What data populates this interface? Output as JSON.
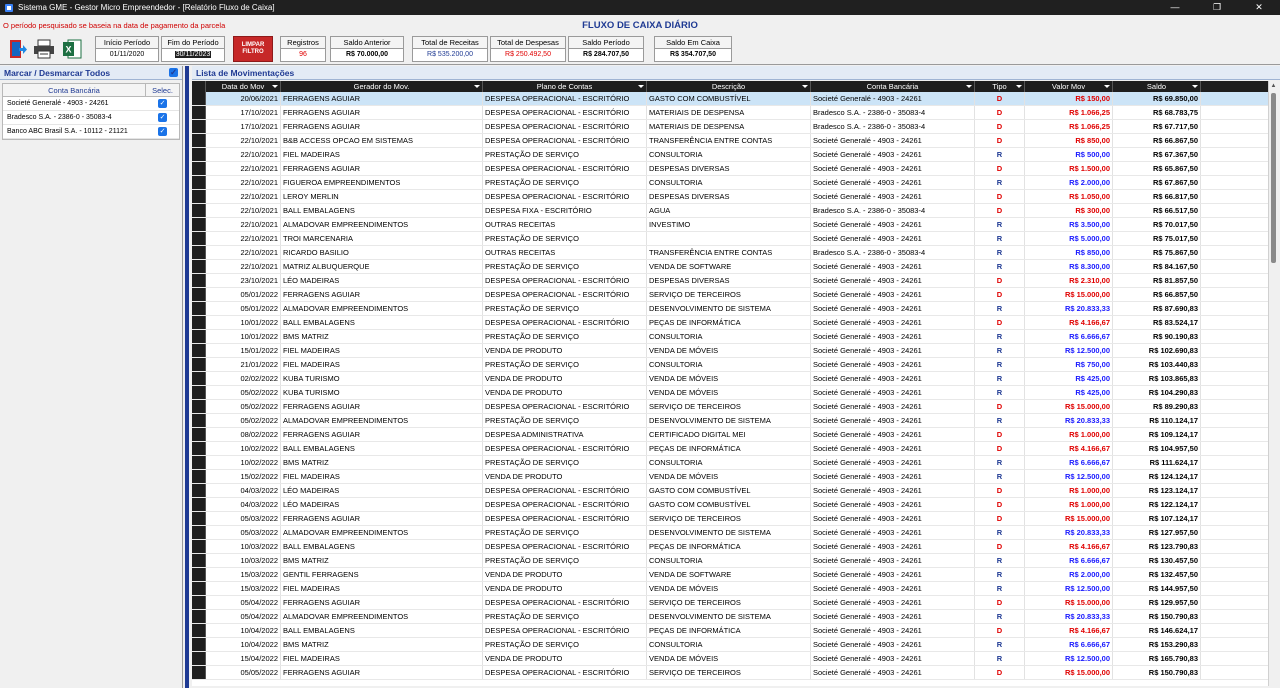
{
  "window": {
    "title": "Sistema GME - Gestor Micro Empreendedor - [Relatório Fluxo de Caixa]"
  },
  "header": {
    "notice": "O período pesquisado se baseia na data de pagamento da parcela",
    "title": "FLUXO DE CAIXA DIÁRIO"
  },
  "filters": {
    "inicio_label": "Início Período",
    "inicio_value": "01/11/2020",
    "fim_label": "Fim do Período",
    "fim_value": "30/11/2023",
    "limpar_label": "LIMPAR FILTRO",
    "registros_label": "Registros",
    "registros_value": "96"
  },
  "summary": {
    "saldo_anterior_label": "Saldo Anterior",
    "saldo_anterior_value": "R$ 70.000,00",
    "total_receitas_label": "Total de Receitas",
    "total_receitas_value": "R$ 535.200,00",
    "total_despesas_label": "Total de Despesas",
    "total_despesas_value": "R$ 250.492,50",
    "saldo_periodo_label": "Saldo Período",
    "saldo_periodo_value": "R$ 284.707,50",
    "saldo_caixa_label": "Saldo Em Caixa",
    "saldo_caixa_value": "R$ 354.707,50",
    "colors": {
      "receita": "#1f3a93",
      "despesa": "#e00000"
    }
  },
  "left": {
    "title": "Marcar / Desmarcar Todos",
    "col_conta": "Conta Bancária",
    "col_selec": "Selec.",
    "accounts": [
      "Societé Generalé - 4903 - 24261",
      "Bradesco S.A. - 2386-0 - 35083-4",
      "Banco ABC Brasil S.A. - 10112 - 21121"
    ]
  },
  "grid": {
    "title": "Lista de Movimentações",
    "headers": [
      "Data do Mov",
      "Gerador do Mov.",
      "Plano de Contas",
      "Descrição",
      "Conta Bancária",
      "Tipo",
      "Valor Mov",
      "Saldo"
    ],
    "rows": [
      [
        "20/06/2021",
        "FERRAGENS AGUIAR",
        "DESPESA OPERACIONAL - ESCRITÓRIO",
        "GASTO COM COMBUSTÍVEL",
        "Societé Generalé - 4903 - 24261",
        "D",
        "R$ 150,00",
        "R$ 69.850,00"
      ],
      [
        "17/10/2021",
        "FERRAGENS AGUIAR",
        "DESPESA OPERACIONAL - ESCRITÓRIO",
        "MATERIAIS DE DESPENSA",
        "Bradesco S.A. - 2386-0 - 35083-4",
        "D",
        "R$ 1.066,25",
        "R$ 68.783,75"
      ],
      [
        "17/10/2021",
        "FERRAGENS AGUIAR",
        "DESPESA OPERACIONAL - ESCRITÓRIO",
        "MATERIAIS DE DESPENSA",
        "Bradesco S.A. - 2386-0 - 35083-4",
        "D",
        "R$ 1.066,25",
        "R$ 67.717,50"
      ],
      [
        "22/10/2021",
        "B&B ACCESS OPCAO EM SISTEMAS",
        "DESPESA OPERACIONAL - ESCRITÓRIO",
        "TRANSFERÊNCIA ENTRE CONTAS",
        "Societé Generalé - 4903 - 24261",
        "D",
        "R$ 850,00",
        "R$ 66.867,50"
      ],
      [
        "22/10/2021",
        "FIEL MADEIRAS",
        "PRESTAÇÃO DE SERVIÇO",
        "CONSULTORIA",
        "Societé Generalé - 4903 - 24261",
        "R",
        "R$ 500,00",
        "R$ 67.367,50"
      ],
      [
        "22/10/2021",
        "FERRAGENS AGUIAR",
        "DESPESA OPERACIONAL - ESCRITÓRIO",
        "DESPESAS DIVERSAS",
        "Societé Generalé - 4903 - 24261",
        "D",
        "R$ 1.500,00",
        "R$ 65.867,50"
      ],
      [
        "22/10/2021",
        "FIGUEROA EMPREENDIMENTOS",
        "PRESTAÇÃO DE SERVIÇO",
        "CONSULTORIA",
        "Societé Generalé - 4903 - 24261",
        "R",
        "R$ 2.000,00",
        "R$ 67.867,50"
      ],
      [
        "22/10/2021",
        "LEROY MERLIN",
        "DESPESA OPERACIONAL - ESCRITÓRIO",
        "DESPESAS DIVERSAS",
        "Societé Generalé - 4903 - 24261",
        "D",
        "R$ 1.050,00",
        "R$ 66.817,50"
      ],
      [
        "22/10/2021",
        "BALL EMBALAGENS",
        "DESPESA FIXA - ESCRITÓRIO",
        "AGUA",
        "Bradesco S.A. - 2386-0 - 35083-4",
        "D",
        "R$ 300,00",
        "R$ 66.517,50"
      ],
      [
        "22/10/2021",
        "ALMADOVAR EMPREENDIMENTOS",
        "OUTRAS RECEITAS",
        "INVESTIMO",
        "Societé Generalé - 4903 - 24261",
        "R",
        "R$ 3.500,00",
        "R$ 70.017,50"
      ],
      [
        "22/10/2021",
        "TROI MARCENARIA",
        "PRESTAÇÃO DE SERVIÇO",
        "",
        "Societé Generalé - 4903 - 24261",
        "R",
        "R$ 5.000,00",
        "R$ 75.017,50"
      ],
      [
        "22/10/2021",
        "RICARDO BASILIO",
        "OUTRAS RECEITAS",
        "TRANSFERÊNCIA ENTRE CONTAS",
        "Bradesco S.A. - 2386-0 - 35083-4",
        "R",
        "R$ 850,00",
        "R$ 75.867,50"
      ],
      [
        "22/10/2021",
        "MATRIZ ALBUQUERQUE",
        "PRESTAÇÃO DE SERVIÇO",
        "VENDA DE SOFTWARE",
        "Societé Generalé - 4903 - 24261",
        "R",
        "R$ 8.300,00",
        "R$ 84.167,50"
      ],
      [
        "23/10/2021",
        "LÉO MADEIRAS",
        "DESPESA OPERACIONAL - ESCRITÓRIO",
        "DESPESAS DIVERSAS",
        "Societé Generalé - 4903 - 24261",
        "D",
        "R$ 2.310,00",
        "R$ 81.857,50"
      ],
      [
        "05/01/2022",
        "FERRAGENS AGUIAR",
        "DESPESA OPERACIONAL - ESCRITÓRIO",
        "SERVIÇO DE TERCEIROS",
        "Societé Generalé - 4903 - 24261",
        "D",
        "R$ 15.000,00",
        "R$ 66.857,50"
      ],
      [
        "05/01/2022",
        "ALMADOVAR EMPREENDIMENTOS",
        "PRESTAÇÃO DE SERVIÇO",
        "DESENVOLVIMENTO DE SISTEMA",
        "Societé Generalé - 4903 - 24261",
        "R",
        "R$ 20.833,33",
        "R$ 87.690,83"
      ],
      [
        "10/01/2022",
        "BALL EMBALAGENS",
        "DESPESA OPERACIONAL - ESCRITÓRIO",
        "PEÇAS DE INFORMÁTICA",
        "Societé Generalé - 4903 - 24261",
        "D",
        "R$ 4.166,67",
        "R$ 83.524,17"
      ],
      [
        "10/01/2022",
        "BMS MATRIZ",
        "PRESTAÇÃO DE SERVIÇO",
        "CONSULTORIA",
        "Societé Generalé - 4903 - 24261",
        "R",
        "R$ 6.666,67",
        "R$ 90.190,83"
      ],
      [
        "15/01/2022",
        "FIEL MADEIRAS",
        "VENDA DE PRODUTO",
        "VENDA DE MÓVEIS",
        "Societé Generalé - 4903 - 24261",
        "R",
        "R$ 12.500,00",
        "R$ 102.690,83"
      ],
      [
        "21/01/2022",
        "FIEL MADEIRAS",
        "PRESTAÇÃO DE SERVIÇO",
        "CONSULTORIA",
        "Societé Generalé - 4903 - 24261",
        "R",
        "R$ 750,00",
        "R$ 103.440,83"
      ],
      [
        "02/02/2022",
        "KUBA TURISMO",
        "VENDA DE PRODUTO",
        "VENDA DE MÓVEIS",
        "Societé Generalé - 4903 - 24261",
        "R",
        "R$ 425,00",
        "R$ 103.865,83"
      ],
      [
        "05/02/2022",
        "KUBA TURISMO",
        "VENDA DE PRODUTO",
        "VENDA DE MÓVEIS",
        "Societé Generalé - 4903 - 24261",
        "R",
        "R$ 425,00",
        "R$ 104.290,83"
      ],
      [
        "05/02/2022",
        "FERRAGENS AGUIAR",
        "DESPESA OPERACIONAL - ESCRITÓRIO",
        "SERVIÇO DE TERCEIROS",
        "Societé Generalé - 4903 - 24261",
        "D",
        "R$ 15.000,00",
        "R$ 89.290,83"
      ],
      [
        "05/02/2022",
        "ALMADOVAR EMPREENDIMENTOS",
        "PRESTAÇÃO DE SERVIÇO",
        "DESENVOLVIMENTO DE SISTEMA",
        "Societé Generalé - 4903 - 24261",
        "R",
        "R$ 20.833,33",
        "R$ 110.124,17"
      ],
      [
        "08/02/2022",
        "FERRAGENS AGUIAR",
        "DESPESA ADMINISTRATIVA",
        "CERTIFICADO DIGITAL MEI",
        "Societé Generalé - 4903 - 24261",
        "D",
        "R$ 1.000,00",
        "R$ 109.124,17"
      ],
      [
        "10/02/2022",
        "BALL EMBALAGENS",
        "DESPESA OPERACIONAL - ESCRITÓRIO",
        "PEÇAS DE INFORMÁTICA",
        "Societé Generalé - 4903 - 24261",
        "D",
        "R$ 4.166,67",
        "R$ 104.957,50"
      ],
      [
        "10/02/2022",
        "BMS MATRIZ",
        "PRESTAÇÃO DE SERVIÇO",
        "CONSULTORIA",
        "Societé Generalé - 4903 - 24261",
        "R",
        "R$ 6.666,67",
        "R$ 111.624,17"
      ],
      [
        "15/02/2022",
        "FIEL MADEIRAS",
        "VENDA DE PRODUTO",
        "VENDA DE MÓVEIS",
        "Societé Generalé - 4903 - 24261",
        "R",
        "R$ 12.500,00",
        "R$ 124.124,17"
      ],
      [
        "04/03/2022",
        "LÉO MADEIRAS",
        "DESPESA OPERACIONAL - ESCRITÓRIO",
        "GASTO COM COMBUSTÍVEL",
        "Societé Generalé - 4903 - 24261",
        "D",
        "R$ 1.000,00",
        "R$ 123.124,17"
      ],
      [
        "04/03/2022",
        "LÉO MADEIRAS",
        "DESPESA OPERACIONAL - ESCRITÓRIO",
        "GASTO COM COMBUSTÍVEL",
        "Societé Generalé - 4903 - 24261",
        "D",
        "R$ 1.000,00",
        "R$ 122.124,17"
      ],
      [
        "05/03/2022",
        "FERRAGENS AGUIAR",
        "DESPESA OPERACIONAL - ESCRITÓRIO",
        "SERVIÇO DE TERCEIROS",
        "Societé Generalé - 4903 - 24261",
        "D",
        "R$ 15.000,00",
        "R$ 107.124,17"
      ],
      [
        "05/03/2022",
        "ALMADOVAR EMPREENDIMENTOS",
        "PRESTAÇÃO DE SERVIÇO",
        "DESENVOLVIMENTO DE SISTEMA",
        "Societé Generalé - 4903 - 24261",
        "R",
        "R$ 20.833,33",
        "R$ 127.957,50"
      ],
      [
        "10/03/2022",
        "BALL EMBALAGENS",
        "DESPESA OPERACIONAL - ESCRITÓRIO",
        "PEÇAS DE INFORMÁTICA",
        "Societé Generalé - 4903 - 24261",
        "D",
        "R$ 4.166,67",
        "R$ 123.790,83"
      ],
      [
        "10/03/2022",
        "BMS MATRIZ",
        "PRESTAÇÃO DE SERVIÇO",
        "CONSULTORIA",
        "Societé Generalé - 4903 - 24261",
        "R",
        "R$ 6.666,67",
        "R$ 130.457,50"
      ],
      [
        "15/03/2022",
        "GENTIL FERRAGENS",
        "VENDA DE PRODUTO",
        "VENDA DE SOFTWARE",
        "Societé Generalé - 4903 - 24261",
        "R",
        "R$ 2.000,00",
        "R$ 132.457,50"
      ],
      [
        "15/03/2022",
        "FIEL MADEIRAS",
        "VENDA DE PRODUTO",
        "VENDA DE MÓVEIS",
        "Societé Generalé - 4903 - 24261",
        "R",
        "R$ 12.500,00",
        "R$ 144.957,50"
      ],
      [
        "05/04/2022",
        "FERRAGENS AGUIAR",
        "DESPESA OPERACIONAL - ESCRITÓRIO",
        "SERVIÇO DE TERCEIROS",
        "Societé Generalé - 4903 - 24261",
        "D",
        "R$ 15.000,00",
        "R$ 129.957,50"
      ],
      [
        "05/04/2022",
        "ALMADOVAR EMPREENDIMENTOS",
        "PRESTAÇÃO DE SERVIÇO",
        "DESENVOLVIMENTO DE SISTEMA",
        "Societé Generalé - 4903 - 24261",
        "R",
        "R$ 20.833,33",
        "R$ 150.790,83"
      ],
      [
        "10/04/2022",
        "BALL EMBALAGENS",
        "DESPESA OPERACIONAL - ESCRITÓRIO",
        "PEÇAS DE INFORMÁTICA",
        "Societé Generalé - 4903 - 24261",
        "D",
        "R$ 4.166,67",
        "R$ 146.624,17"
      ],
      [
        "10/04/2022",
        "BMS MATRIZ",
        "PRESTAÇÃO DE SERVIÇO",
        "CONSULTORIA",
        "Societé Generalé - 4903 - 24261",
        "R",
        "R$ 6.666,67",
        "R$ 153.290,83"
      ],
      [
        "15/04/2022",
        "FIEL MADEIRAS",
        "VENDA DE PRODUTO",
        "VENDA DE MÓVEIS",
        "Societé Generalé - 4903 - 24261",
        "R",
        "R$ 12.500,00",
        "R$ 165.790,83"
      ],
      [
        "05/05/2022",
        "FERRAGENS AGUIAR",
        "DESPESA OPERACIONAL - ESCRITÓRIO",
        "SERVIÇO DE TERCEIROS",
        "Societé Generalé - 4903 - 24261",
        "D",
        "R$ 15.000,00",
        "R$ 150.790,83"
      ]
    ]
  }
}
